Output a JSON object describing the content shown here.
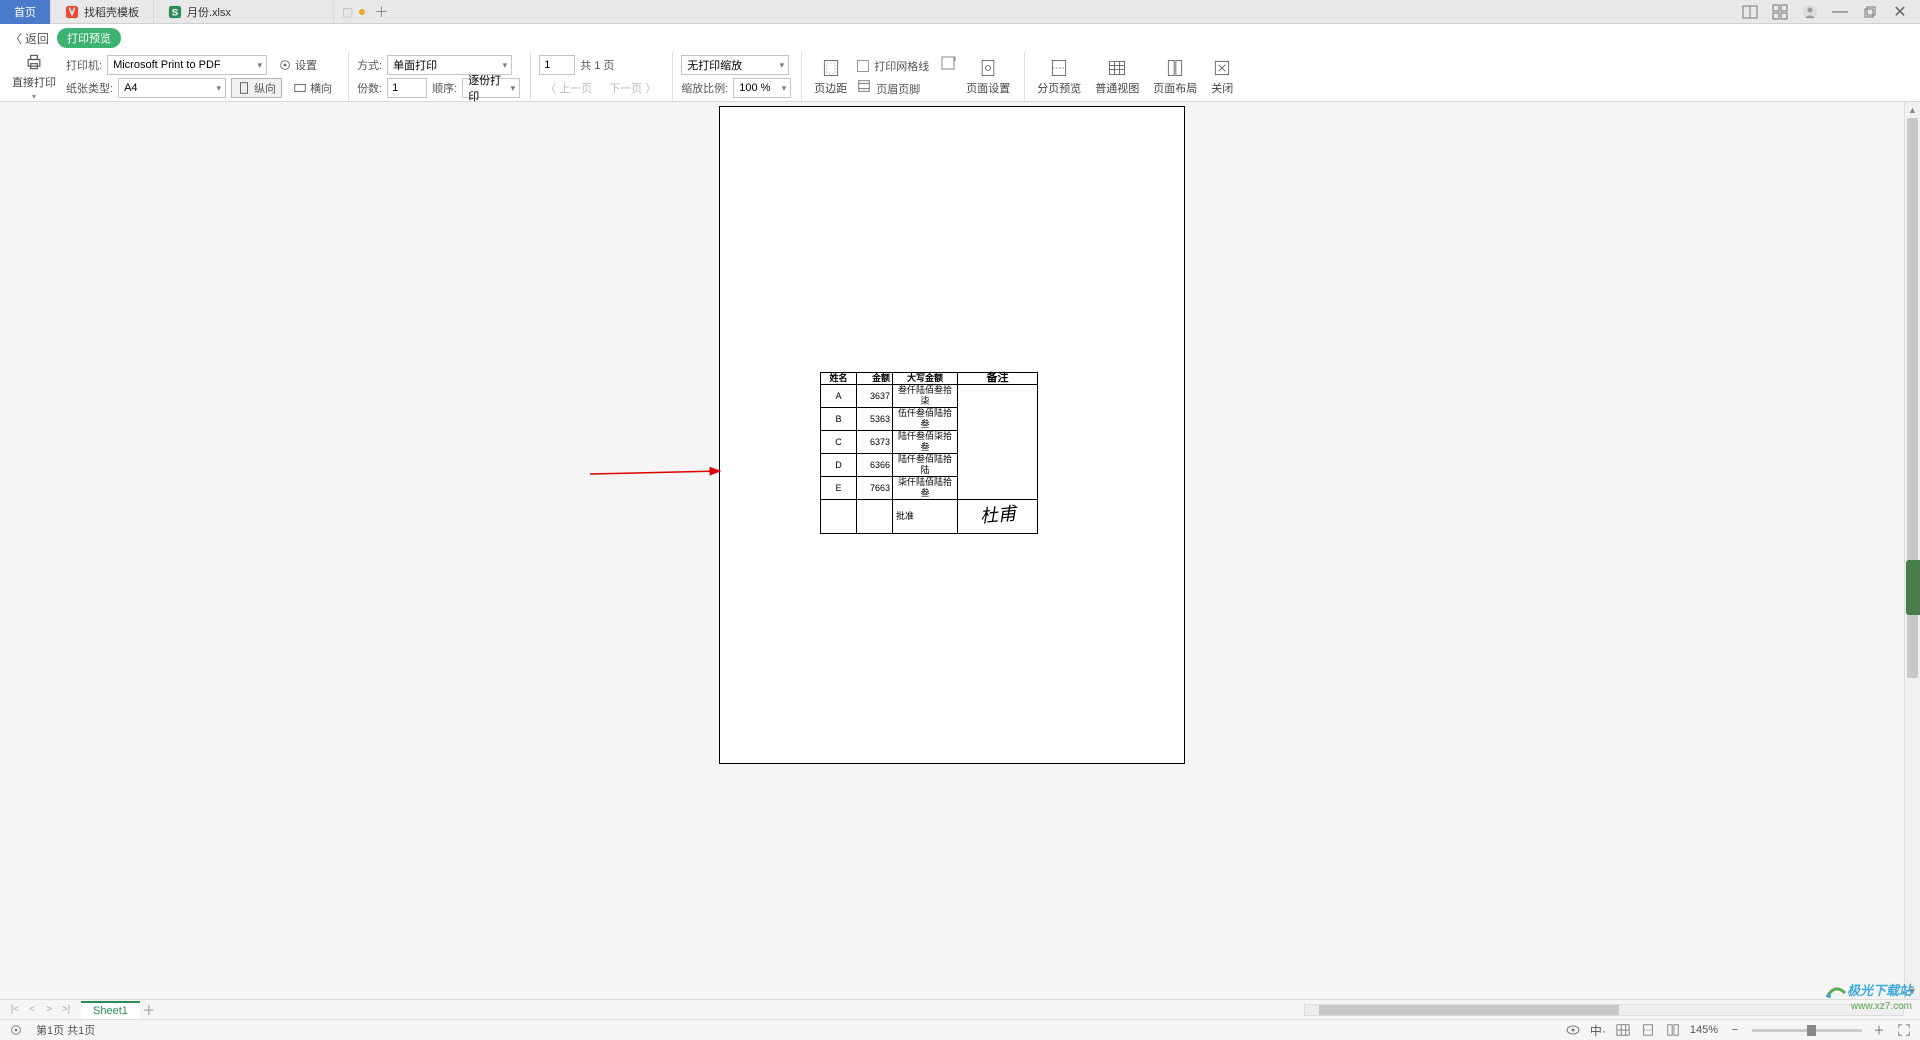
{
  "tabs": {
    "home": "首页",
    "template": "找稻壳模板",
    "file": "月份.xlsx"
  },
  "back": {
    "label": "返回",
    "badge": "打印预览"
  },
  "toolbar": {
    "direct_print": "直接打印",
    "printer_label": "打印机:",
    "printer_value": "Microsoft Print to PDF",
    "paper_label": "纸张类型:",
    "paper_value": "A4",
    "settings": "设置",
    "portrait": "纵向",
    "landscape": "横向",
    "method_label": "方式:",
    "method_value": "单面打印",
    "copies_label": "份数:",
    "copies_value": "1",
    "order_label": "顺序:",
    "order_value": "逐份打印",
    "page_value": "1",
    "total_pages": "共 1 页",
    "prev_page": "上一页",
    "next_page": "下一页",
    "scale_label": "无打印缩放",
    "zoom_label": "缩放比例:",
    "zoom_value": "100 %",
    "margins": "页边距",
    "gridlines": "打印网格线",
    "header_footer": "页眉页脚",
    "page_setup": "页面设置",
    "page_break": "分页预览",
    "normal_view": "普通视图",
    "page_layout": "页面布局",
    "close": "关闭"
  },
  "table": {
    "headers": {
      "name": "姓名",
      "amount": "金额",
      "upper": "大写金额",
      "note": "备注"
    },
    "rows": [
      {
        "name": "A",
        "amount": "3637",
        "upper": "叁仟陆佰叁拾柒"
      },
      {
        "name": "B",
        "amount": "5363",
        "upper": "伍仟叁佰陆拾叁"
      },
      {
        "name": "C",
        "amount": "6373",
        "upper": "陆仟叁佰柒拾叁"
      },
      {
        "name": "D",
        "amount": "6366",
        "upper": "陆仟叁佰陆拾陆"
      },
      {
        "name": "E",
        "amount": "7663",
        "upper": "柒仟陆佰陆拾叁"
      }
    ],
    "approve": "批准"
  },
  "sheet": {
    "name": "Sheet1"
  },
  "status": {
    "page_info": "第1页 共1页",
    "zoom": "145%"
  },
  "watermark": {
    "line1": "极光下载站",
    "line2": "www.xz7.com"
  }
}
